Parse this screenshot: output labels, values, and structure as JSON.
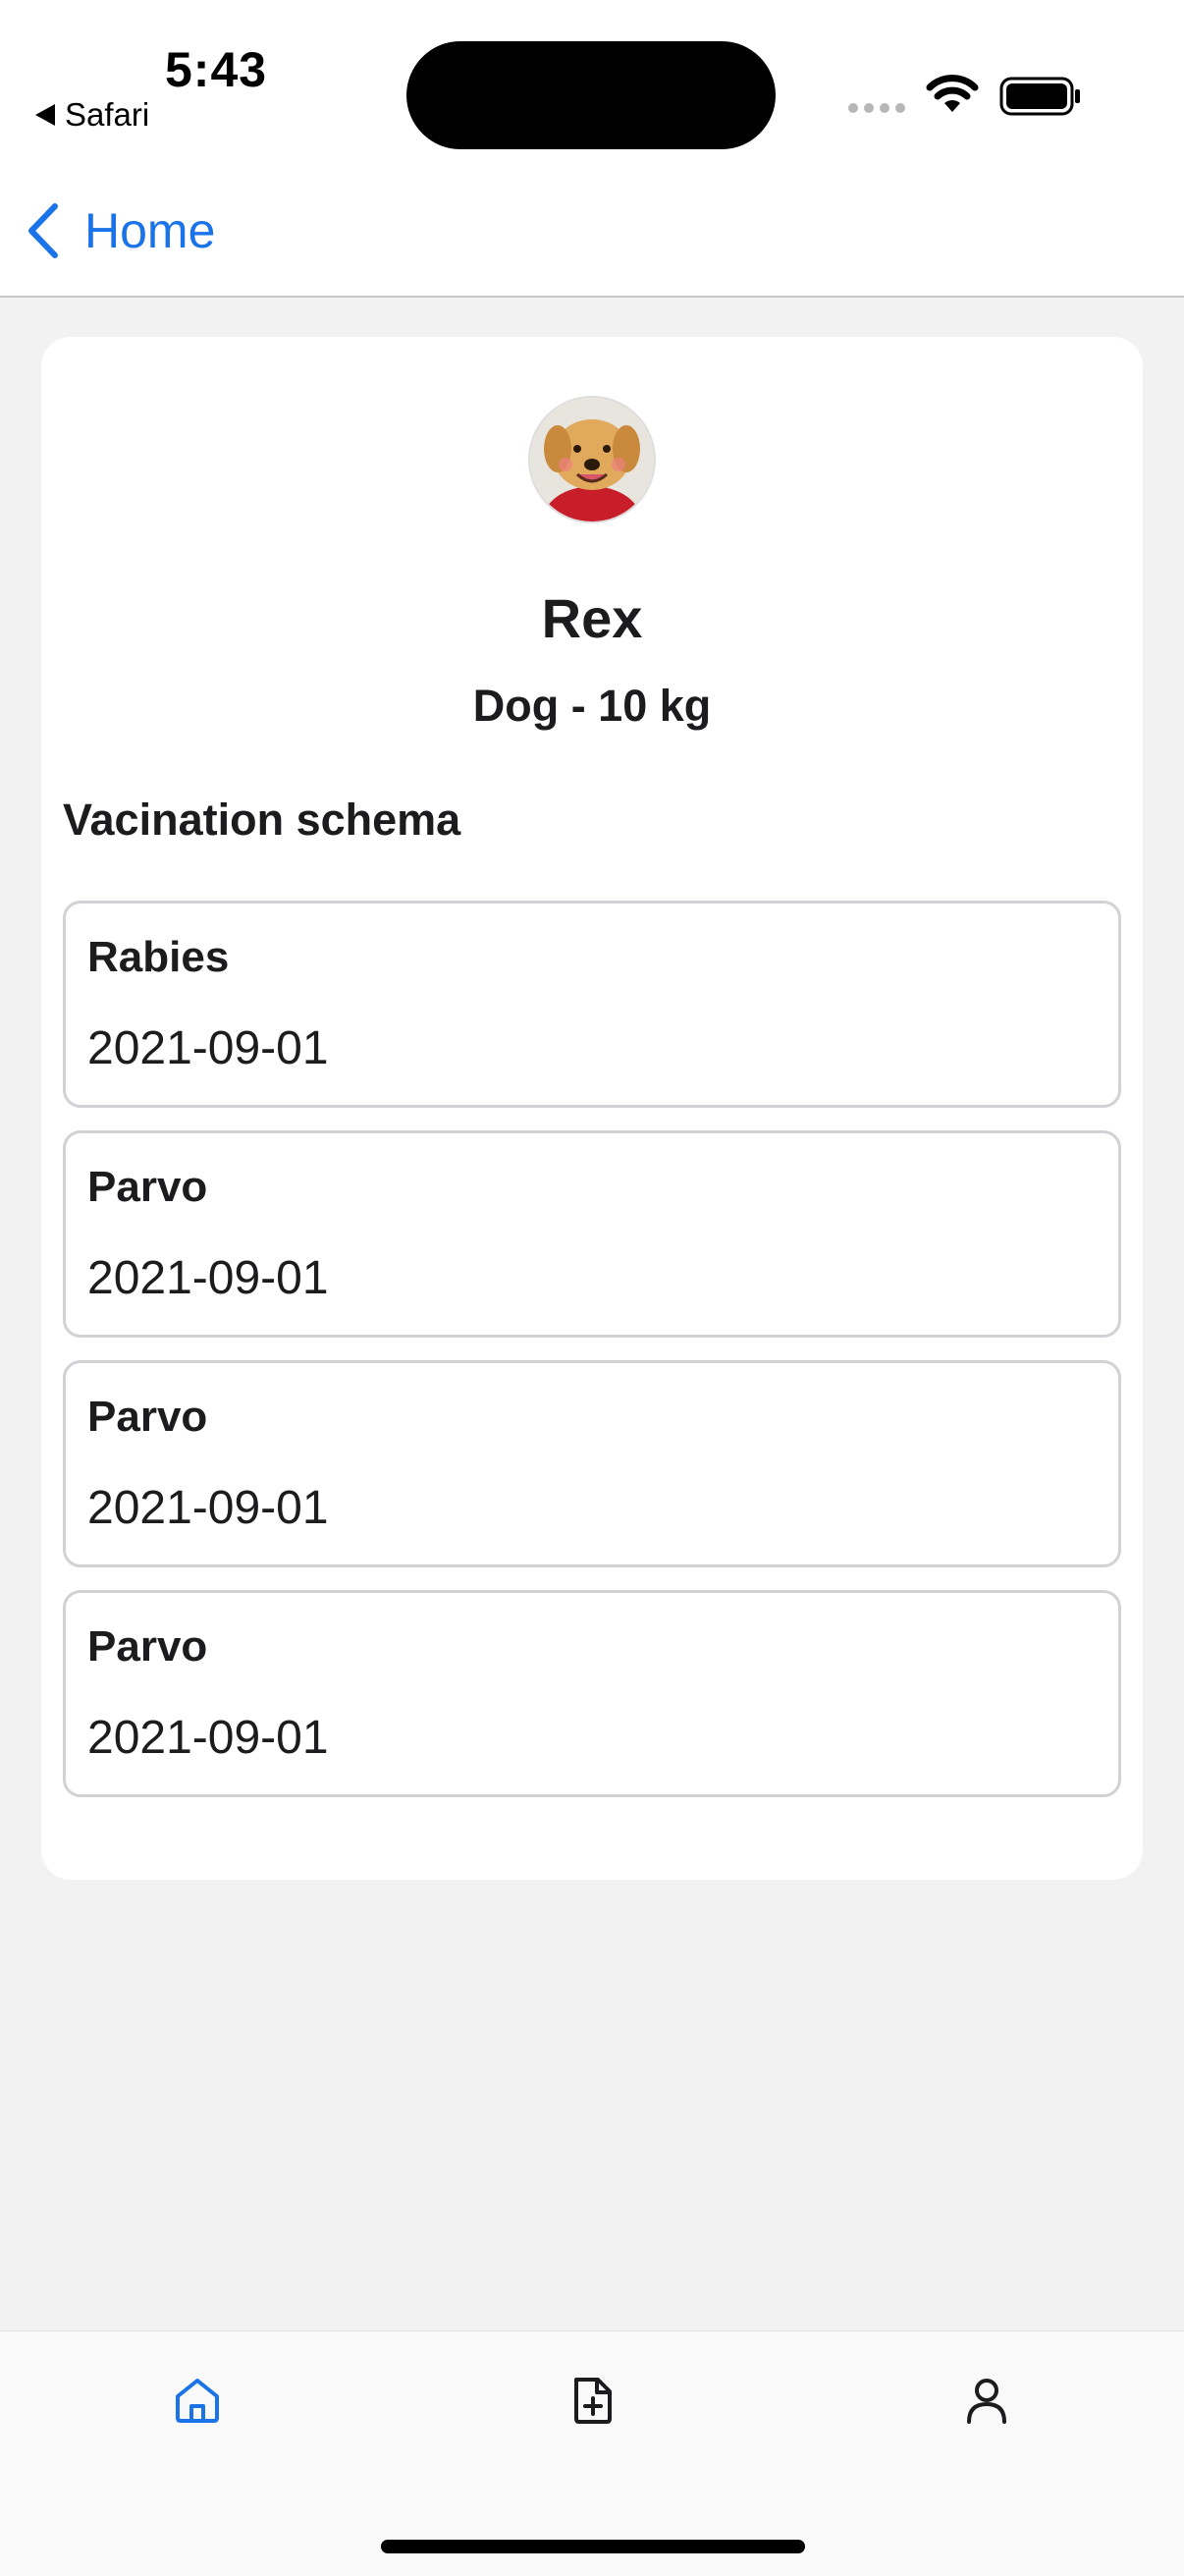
{
  "status_bar": {
    "time": "5:43",
    "back_app": "Safari"
  },
  "nav": {
    "back_label": "Home",
    "accent_color": "#1a73e8"
  },
  "pet": {
    "name": "Rex",
    "info": "Dog - 10 kg",
    "avatar_icon": "dog-photo"
  },
  "vaccination": {
    "title": "Vacination schema",
    "items": [
      {
        "name": "Rabies",
        "date": "2021-09-01"
      },
      {
        "name": "Parvo",
        "date": "2021-09-01"
      },
      {
        "name": "Parvo",
        "date": "2021-09-01"
      },
      {
        "name": "Parvo",
        "date": "2021-09-01"
      }
    ]
  },
  "tab_bar": {
    "tabs": [
      {
        "icon": "home-icon",
        "active": true
      },
      {
        "icon": "add-document-icon",
        "active": false
      },
      {
        "icon": "profile-icon",
        "active": false
      }
    ]
  }
}
